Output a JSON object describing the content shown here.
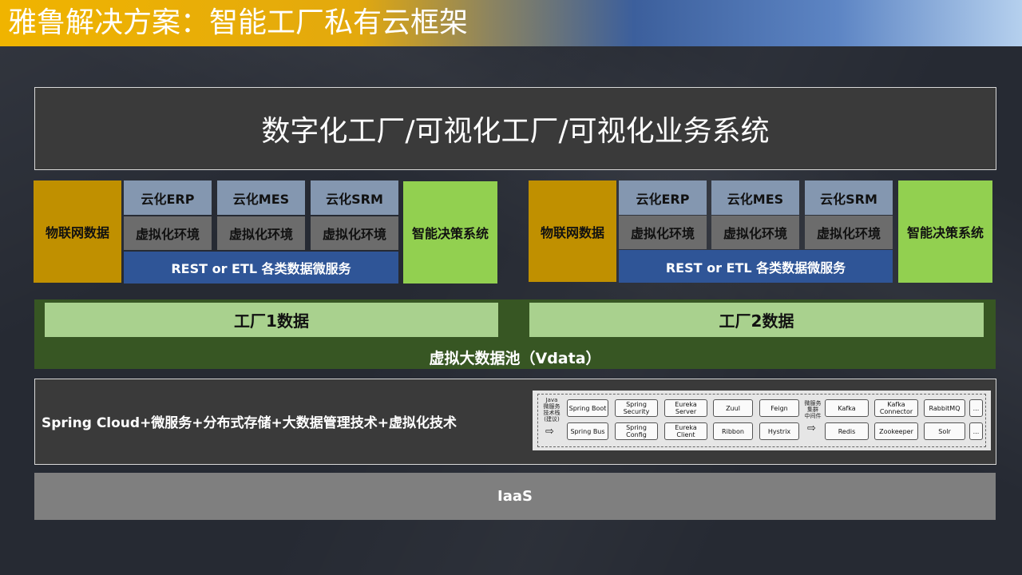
{
  "title": "雅鲁解决方案：智能工厂私有云框架",
  "top_system": "数字化工厂/可视化工厂/可视化业务系统",
  "factories": [
    {
      "iot": "物联网数据",
      "apps": [
        {
          "name": "云化ERP",
          "env": "虚拟化环境"
        },
        {
          "name": "云化MES",
          "env": "虚拟化环境"
        },
        {
          "name": "云化SRM",
          "env": "虚拟化环境"
        }
      ],
      "rest": "REST or ETL 各类数据微服务",
      "decision": "智能决策系统",
      "data": "工厂1数据"
    },
    {
      "iot": "物联网数据",
      "apps": [
        {
          "name": "云化ERP",
          "env": "虚拟化环境"
        },
        {
          "name": "云化MES",
          "env": "虚拟化环境"
        },
        {
          "name": "云化SRM",
          "env": "虚拟化环境"
        }
      ],
      "rest": "REST or ETL 各类数据微服务",
      "decision": "智能决策系统",
      "data": "工厂2数据"
    }
  ],
  "data_pool": "虚拟大数据池（Vdata）",
  "tech_stack": {
    "label": "Spring Cloud+微服务+分布式存储+大数据管理技术+虚拟化技术",
    "java_label": "Java\n微服务\n技术栈\n(建议)",
    "java_items": [
      [
        "Spring Boot",
        "Spring\nSecurity",
        "Eureka\nServer",
        "Zuul",
        "Feign"
      ],
      [
        "Spring Bus",
        "Spring Config",
        "Eureka Client",
        "Ribbon",
        "Hystrix"
      ]
    ],
    "mw_label": "微服务\n集群\n中间件",
    "mw_items": [
      [
        "Kafka",
        "Kafka\nConnector",
        "RabbitMQ",
        "..."
      ],
      [
        "Redis",
        "Zookeeper",
        "Solr",
        "..."
      ]
    ],
    "arrow": "⇨"
  },
  "iaas": "IaaS"
}
